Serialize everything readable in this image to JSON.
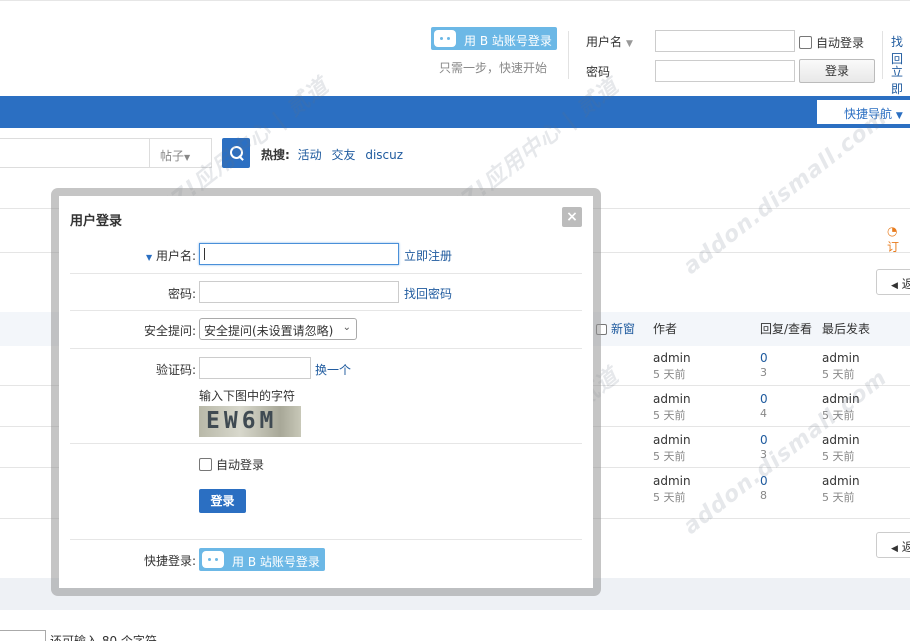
{
  "header": {
    "bili_login_label": "用 B 站账号登录",
    "bili_subtitle": "只需一步，快速开始",
    "username_label": "用户名",
    "password_label": "密码",
    "auto_login": "自动登录",
    "login_button": "登录",
    "find_password": "找回",
    "register": "立即"
  },
  "nav": {
    "quick_nav": "快捷导航"
  },
  "search": {
    "type": "帖子",
    "hot_label": "热搜:",
    "hot_keywords": [
      "活动",
      "交友",
      "discuz"
    ]
  },
  "threads": {
    "rss": "订",
    "back_label": "返",
    "columns": {
      "new_window": "新窗",
      "author": "作者",
      "reply_view": "回复/查看",
      "last_post": "最后发表"
    },
    "rows": [
      {
        "author": "admin",
        "author_time": "5 天前",
        "replies": "0",
        "views": "3",
        "last_user": "admin",
        "last_time": "5 天前"
      },
      {
        "author": "admin",
        "author_time": "5 天前",
        "replies": "0",
        "views": "4",
        "last_user": "admin",
        "last_time": "5 天前"
      },
      {
        "author": "admin",
        "author_time": "5 天前",
        "replies": "0",
        "views": "3",
        "last_user": "admin",
        "last_time": "5 天前"
      },
      {
        "author": "admin",
        "author_time": "5 天前",
        "replies": "0",
        "views": "8",
        "last_user": "admin",
        "last_time": "5 天前"
      }
    ],
    "pager_text": "还可输入 80 个字符"
  },
  "watermark": {
    "line1": "DISCUZ!应用中心 | 贰道",
    "line2": "addon.dismall.com"
  },
  "modal": {
    "title": "用户登录",
    "close": "×",
    "username_label": "用户名:",
    "register_link": "立即注册",
    "password_label": "密码:",
    "find_password_link": "找回密码",
    "question_label": "安全提问:",
    "question_value": "安全提问(未设置请忽略)",
    "captcha_label": "验证码:",
    "captcha_change": "换一个",
    "captcha_hint": "输入下图中的字符",
    "captcha_text": "EW6M",
    "auto_login": "自动登录",
    "submit": "登录",
    "quick_login_label": "快捷登录:",
    "bili_login_label": "用 B 站账号登录"
  }
}
